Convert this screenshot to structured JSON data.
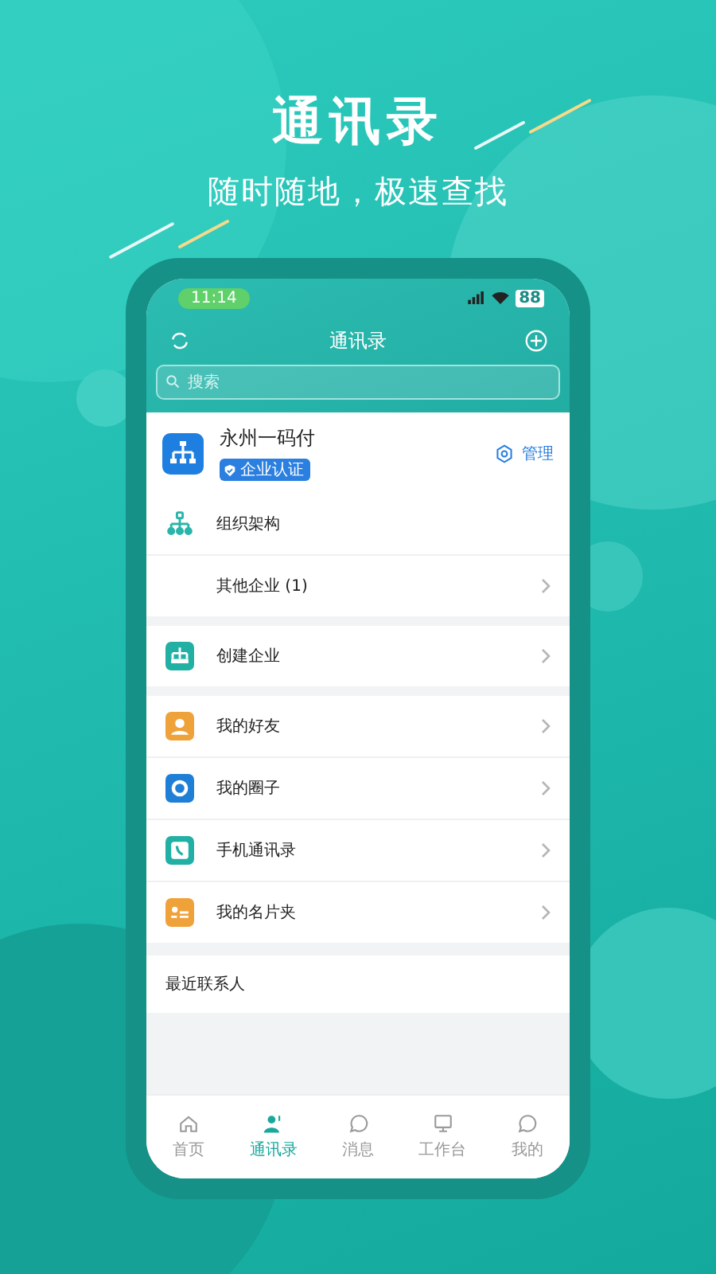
{
  "hero": {
    "title": "通讯录",
    "subtitle": "随时随地，极速查找"
  },
  "status_bar": {
    "time": "11:14",
    "battery": "88"
  },
  "header": {
    "title": "通讯录"
  },
  "search": {
    "placeholder": "搜索"
  },
  "company": {
    "name": "永州一码付",
    "badge": "企业认证",
    "manage": "管理"
  },
  "sections": [
    [
      {
        "kind": "org",
        "label": "组织架构",
        "chevron": false
      },
      {
        "kind": "none",
        "label": "其他企业 (1)",
        "chevron": true
      }
    ],
    [
      {
        "kind": "create",
        "label": "创建企业",
        "chevron": true
      }
    ],
    [
      {
        "kind": "friend",
        "label": "我的好友",
        "chevron": true
      },
      {
        "kind": "circle",
        "label": "我的圈子",
        "chevron": true
      },
      {
        "kind": "phone",
        "label": "手机通讯录",
        "chevron": true
      },
      {
        "kind": "card",
        "label": "我的名片夹",
        "chevron": true
      }
    ]
  ],
  "recent": {
    "label": "最近联系人"
  },
  "tabs": [
    {
      "kind": "home",
      "label": "首页",
      "selected": false
    },
    {
      "kind": "contacts",
      "label": "通讯录",
      "selected": true
    },
    {
      "kind": "chat",
      "label": "消息",
      "selected": false
    },
    {
      "kind": "desk",
      "label": "工作台",
      "selected": false
    },
    {
      "kind": "chat",
      "label": "我的",
      "selected": false
    }
  ]
}
